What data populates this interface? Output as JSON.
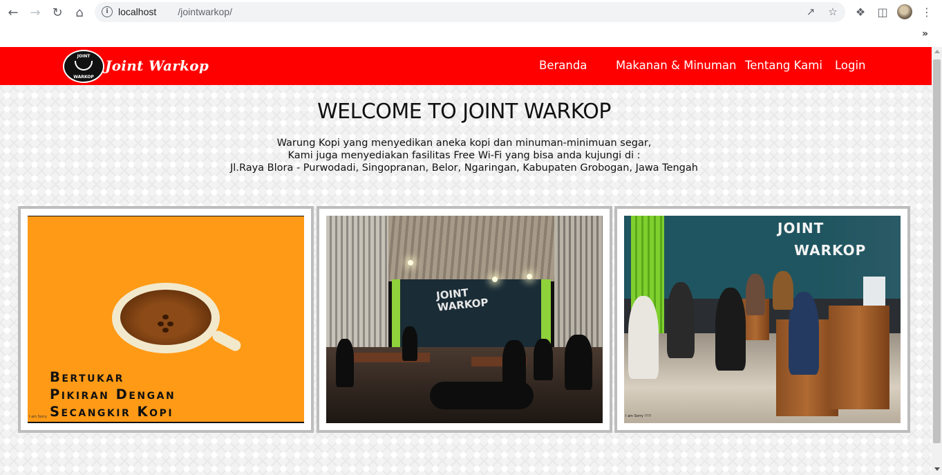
{
  "browser": {
    "url_host": "localhost",
    "url_path": "/jointwarkop/",
    "icons": [
      "back-arrow-icon",
      "forward-arrow-icon",
      "reload-icon",
      "home-icon",
      "info-icon",
      "share-icon",
      "star-icon",
      "extensions-icon",
      "sidebar-icon",
      "menu-icon"
    ]
  },
  "navbar": {
    "brand": "Joint Warkop",
    "logo_top_text": "JOINT",
    "logo_bottom_text": "WARKOP",
    "links": [
      "Beranda",
      "Makanan & Minuman",
      "Tentang Kami",
      "Login"
    ]
  },
  "hero": {
    "title": "WELCOME TO JOINT WARKOP",
    "lines": [
      "Warung Kopi yang menyedikan aneka kopi dan minuman-minimuan segar,",
      "Kami juga menyediakan fasilitas Free Wi-Fi yang bisa anda kujungi di :",
      "Jl.Raya Blora - Purwodadi, Singopranan, Belor, Ngaringan, Kabupaten Grobogan, Jawa Tengah"
    ]
  },
  "gallery": {
    "card1": {
      "text_lines": [
        "Bertukar",
        "Pikiran Dengan",
        "Secangkir Kopi"
      ],
      "watermark": "I am Sorry"
    },
    "card2": {
      "sign_lines": [
        "JOINT",
        "WARKOP"
      ]
    },
    "card3": {
      "sign_lines": [
        "JOINT",
        "WARKOP"
      ],
      "watermark": "I am Sorry !!!!!"
    }
  },
  "colors": {
    "navbar": "#ff0000",
    "card_border": "#bdbdbd"
  }
}
